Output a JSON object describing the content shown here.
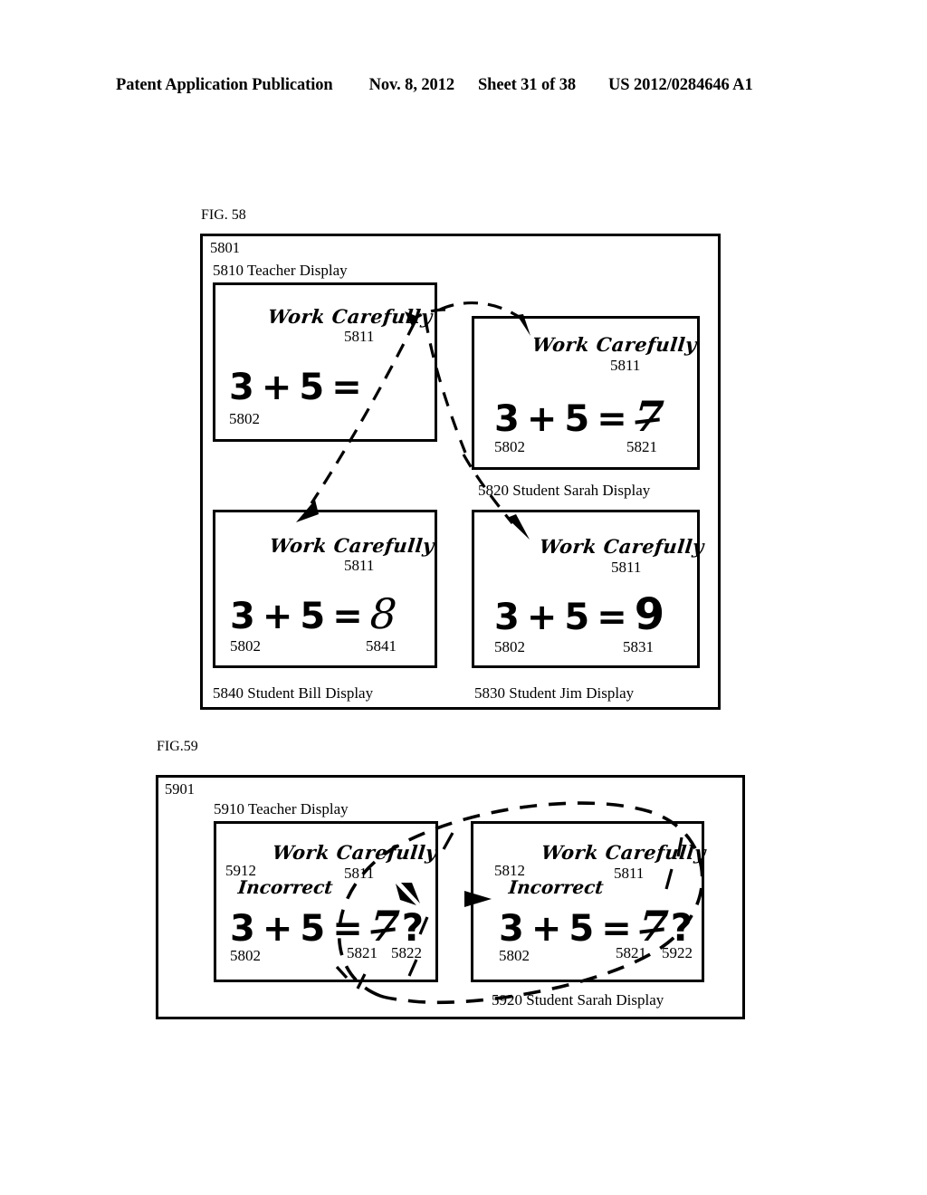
{
  "header": {
    "publication": "Patent Application Publication",
    "date": "Nov. 8, 2012",
    "sheet": "Sheet 31 of 38",
    "patent_number": "US 2012/0284646 A1"
  },
  "figures": [
    {
      "label": "FIG. 58",
      "frame_ref": "5801",
      "panels": [
        {
          "title": "5810   Teacher Display",
          "prompt": "Work Carefully",
          "prompt_ref": "5811",
          "equation": {
            "a": "3",
            "plus": "+",
            "b": "5",
            "equals": "=",
            "answer": ""
          },
          "equation_ref": "5802",
          "answer_ref": "",
          "caption": ""
        },
        {
          "title": "",
          "prompt": "Work Carefully",
          "prompt_ref": "5811",
          "equation": {
            "a": "3",
            "plus": "+",
            "b": "5",
            "equals": "=",
            "answer": "7"
          },
          "equation_ref": "5802",
          "answer_ref": "5821",
          "caption": "5820 Student Sarah Display"
        },
        {
          "title": "",
          "prompt": "Work Carefully",
          "prompt_ref": "5811",
          "equation": {
            "a": "3",
            "plus": "+",
            "b": "5",
            "equals": "=",
            "answer": "8"
          },
          "equation_ref": "5802",
          "answer_ref": "5841",
          "caption": "5840 Student Bill Display"
        },
        {
          "title": "",
          "prompt": "Work Carefully",
          "prompt_ref": "5811",
          "equation": {
            "a": "3",
            "plus": "+",
            "b": "5",
            "equals": "=",
            "answer": "9"
          },
          "equation_ref": "5802",
          "answer_ref": "5831",
          "caption": "5830  Student Jim Display"
        }
      ]
    },
    {
      "label": "FIG.59",
      "frame_ref": "5901",
      "panels": [
        {
          "title": "5910 Teacher Display",
          "prompt": "Work Carefully",
          "prompt_ref": "5811",
          "feedback": "Incorrect",
          "feedback_ref": "5912",
          "equation": {
            "a": "3",
            "plus": "+",
            "b": "5",
            "equals": "=",
            "answer": "7",
            "query": "?"
          },
          "equation_ref": "5802",
          "answer_ref": "5821",
          "query_ref": "5822",
          "caption": ""
        },
        {
          "title": "",
          "prompt": "Work Carefully",
          "prompt_ref": "5811",
          "feedback": "Incorrect",
          "feedback_ref": "5812",
          "equation": {
            "a": "3",
            "plus": "+",
            "b": "5",
            "equals": "=",
            "answer": "7",
            "query": "?"
          },
          "equation_ref": "5802",
          "answer_ref": "5821",
          "query_ref": "5922",
          "caption": "5920 Student Sarah Display"
        }
      ]
    }
  ],
  "colors": {
    "ink": "#000000",
    "paper": "#ffffff"
  }
}
